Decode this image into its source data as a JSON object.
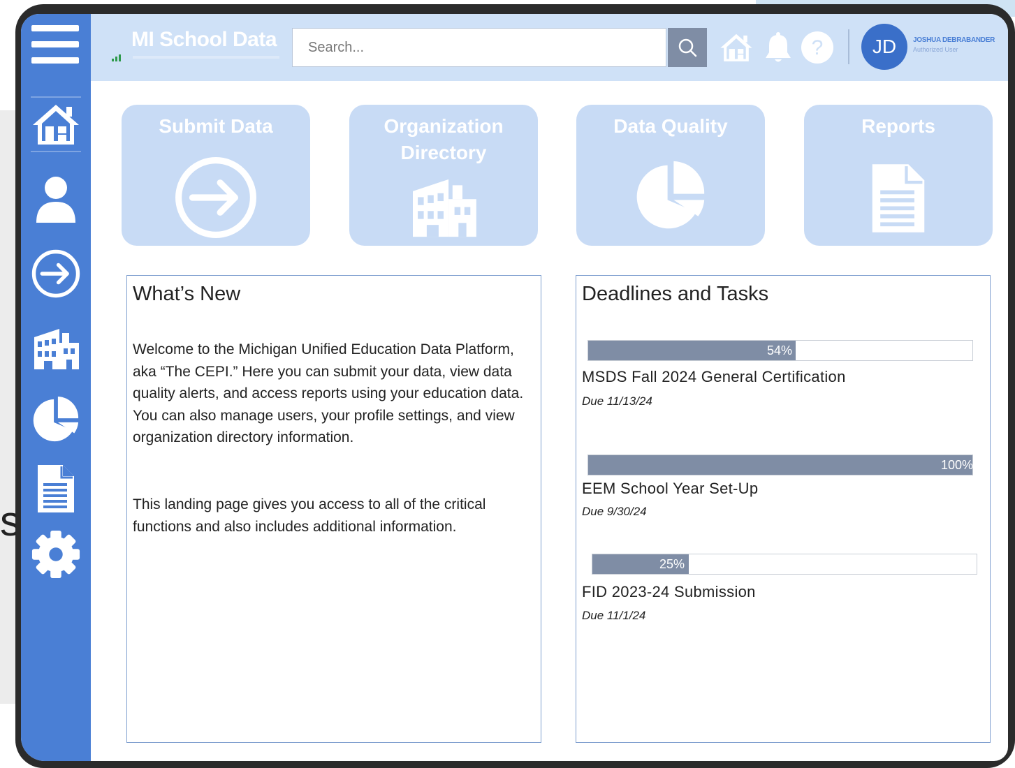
{
  "app": {
    "title": "MI School Data"
  },
  "search": {
    "placeholder": "Search..."
  },
  "user": {
    "initials": "JD",
    "name": "JOSHUA DEBRABANDER",
    "role": "Authorized User"
  },
  "sidebar": {
    "items": [
      {
        "name": "home",
        "icon": "home-icon"
      },
      {
        "name": "profile",
        "icon": "person-icon"
      },
      {
        "name": "submit",
        "icon": "arrow-circle-icon"
      },
      {
        "name": "organization",
        "icon": "building-icon"
      },
      {
        "name": "data-quality",
        "icon": "pie-chart-icon"
      },
      {
        "name": "reports",
        "icon": "document-icon"
      },
      {
        "name": "settings",
        "icon": "gear-icon"
      }
    ]
  },
  "tiles": [
    {
      "title": "Submit Data",
      "icon": "arrow-circle-icon"
    },
    {
      "title": "Organization Directory",
      "icon": "building-icon"
    },
    {
      "title": "Data Quality",
      "icon": "pie-chart-icon"
    },
    {
      "title": "Reports",
      "icon": "document-icon"
    }
  ],
  "whats_new": {
    "title": "What’s New",
    "paragraph1": "Welcome to the Michigan Unified Education Data Platform, aka “The CEPI.” Here you can submit your data, view data quality alerts, and access reports using your education data. You can also manage users, your profile settings, and view organization directory information.",
    "paragraph2": "This landing page gives you access to all of the critical functions and also includes additional information."
  },
  "deadlines": {
    "title": "Deadlines and Tasks",
    "tasks": [
      {
        "name": "MSDS Fall 2024 General Certification",
        "due": "Due 11/13/24",
        "progress_label": "54%",
        "progress": 0.54
      },
      {
        "name": "EEM School Year Set-Up",
        "due": "Due 9/30/24",
        "progress_label": "100%",
        "progress": 1.0
      },
      {
        "name": "FID 2023-24 Submission",
        "due": "Due 11/1/24",
        "progress_label": "25%",
        "progress": 0.25
      }
    ]
  },
  "colors": {
    "sidebar": "#4a7fd5",
    "topbar": "#cfe1f7",
    "tile": "#c8dbf5",
    "progress": "#7f8da5"
  }
}
